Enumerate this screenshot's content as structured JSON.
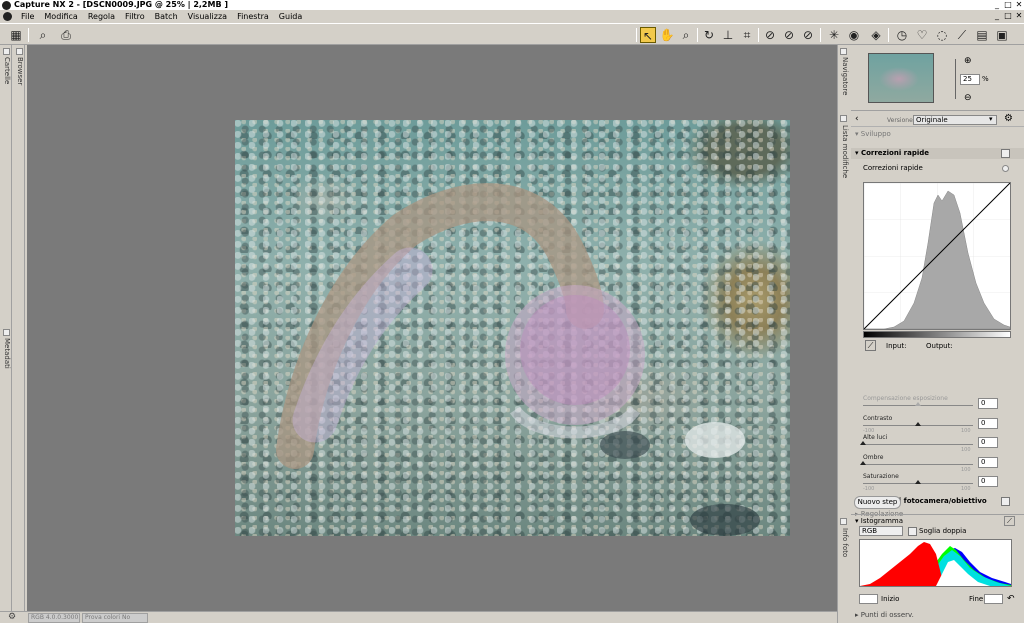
{
  "window": {
    "title": "Capture NX 2 - [DSCN0009.JPG @ 25% | 2,2MB ]",
    "minimize": "_",
    "maximize": "□",
    "close": "✕"
  },
  "menu": {
    "items": [
      "File",
      "Modifica",
      "Regola",
      "Filtro",
      "Batch",
      "Visualizza",
      "Finestra",
      "Guida"
    ],
    "doc_controls": [
      "_",
      "□",
      "✕"
    ]
  },
  "left_sidebar": {
    "tabs": [
      "Cartelle",
      "Browser",
      "Metadati"
    ]
  },
  "status_bar": {
    "color_info": "RGB 4.0.0.3000",
    "proof_label": "Prova colori No"
  },
  "navigator": {
    "tab_label": "Navigatore",
    "zoom_value": "25",
    "zoom_unit": "%"
  },
  "edit_list": {
    "tab_label": "Lista modifiche",
    "version_label": "Versione",
    "version_value": "Originale",
    "sviluppo": "Sviluppo",
    "quick_fix_header": "Correzioni rapide",
    "quick_fix_sub": "Correzioni rapide",
    "input_label": "Input:",
    "output_label": "Output:",
    "sliders": [
      {
        "label": "Compensazione esposizione",
        "value": "0",
        "enabled": false,
        "pos": 0.5,
        "min": "",
        "max": ""
      },
      {
        "label": "Contrasto",
        "value": "0",
        "enabled": true,
        "pos": 0.5,
        "min": "-100",
        "max": "100"
      },
      {
        "label": "Alte luci",
        "value": "0",
        "enabled": true,
        "pos": 0.0,
        "min": "",
        "max": "100"
      },
      {
        "label": "Ombre",
        "value": "0",
        "enabled": true,
        "pos": 0.0,
        "min": "",
        "max": "100"
      },
      {
        "label": "Saturazione",
        "value": "0",
        "enabled": true,
        "pos": 0.5,
        "min": "-100",
        "max": "100"
      }
    ],
    "camera_fix": "Correzioni fotocamera/obiettivo",
    "regolazione": "Regolazione",
    "new_step": "Nuovo step"
  },
  "histogram": {
    "tab_label": "Info foto",
    "title": "Istogramma",
    "channel": "RGB",
    "double_threshold": "Soglia doppia",
    "start_label": "Inizio",
    "end_label": "Fine",
    "start_value": "",
    "end_value": "",
    "points_label": "Punti di osserv."
  },
  "colors": {
    "canvas_bg": "#7a7a7a",
    "panel_bg": "#d4d0c8",
    "active_tool": "#f2c94c"
  }
}
